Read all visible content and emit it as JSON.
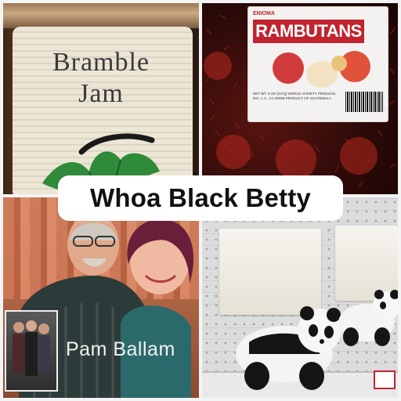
{
  "caption": "Whoa Black Betty",
  "panels": {
    "jam": {
      "title_line1": "Bramble",
      "title_line2": "Jam"
    },
    "rambutans": {
      "brand": "ENIOMA",
      "title": "RAMBUTANS",
      "fine_print": "NET WT. 8 OZ (227g) WORLD VARIETY PRODUCE, INC. L.A., CA 90058 PRODUCT OF GUATEMALA"
    },
    "couple": {
      "name": "Pam Ballam"
    },
    "pandas": {}
  },
  "colors": {
    "accent_red": "#c0242f",
    "leaf_green": "#2f8a3a",
    "caption_bg": "#ffffff"
  }
}
